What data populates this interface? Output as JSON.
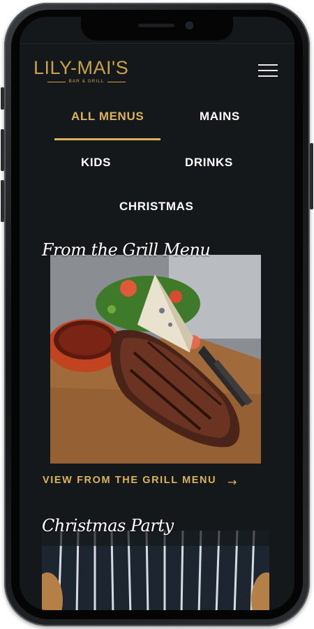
{
  "brand": {
    "name": "LILY-MAI'S",
    "tagline": "BAR & GRILL",
    "accent_color": "#d9b45c"
  },
  "header": {
    "menu_icon": "hamburger-icon"
  },
  "tabs": [
    {
      "label": "ALL MENUS",
      "active": true
    },
    {
      "label": "MAINS",
      "active": false
    },
    {
      "label": "KIDS",
      "active": false
    },
    {
      "label": "DRINKS",
      "active": false
    },
    {
      "label": "CHRISTMAS",
      "active": false
    }
  ],
  "sections": [
    {
      "title": "From the Grill Menu",
      "image": "steak-on-board-photo",
      "link_label": "VIEW FROM THE GRILL MENU",
      "link_icon": "arrow-right-icon",
      "link_arrow": "→"
    },
    {
      "title": "Christmas Party",
      "image": "striped-apron-photo"
    }
  ]
}
